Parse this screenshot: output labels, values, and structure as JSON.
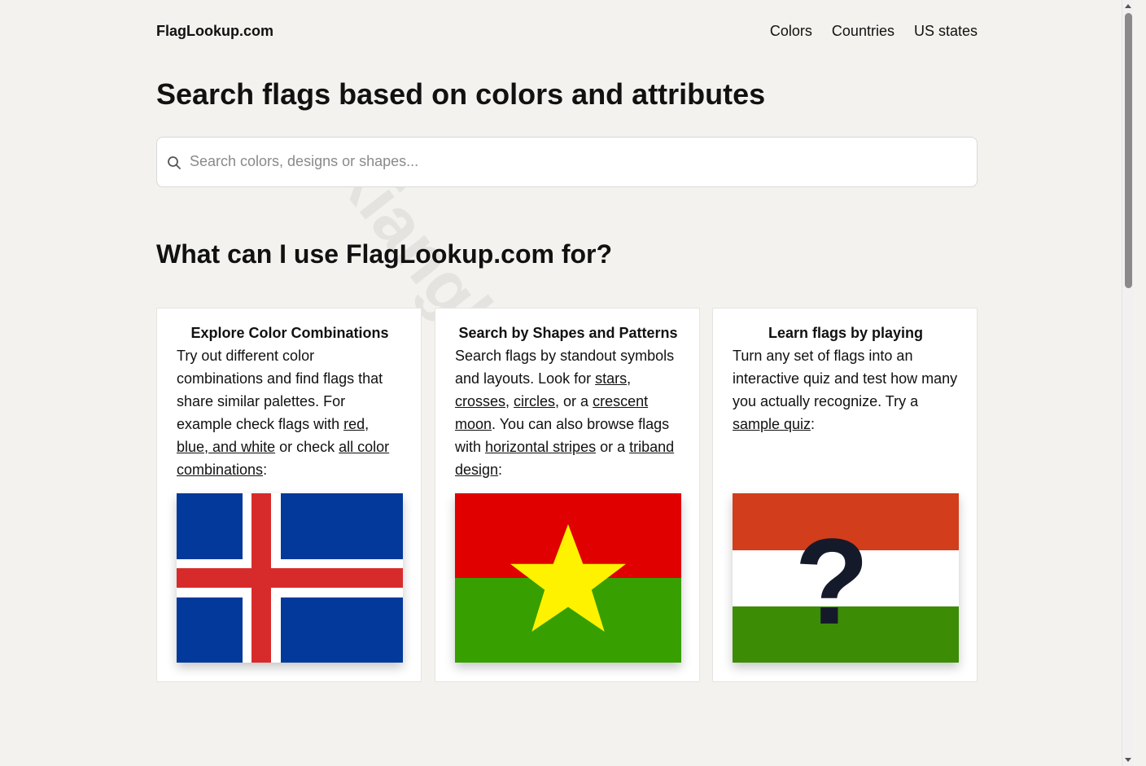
{
  "header": {
    "logo": "FlagLookup.com",
    "nav": [
      "Colors",
      "Countries",
      "US states"
    ]
  },
  "hero": {
    "title": "Search flags based on colors and attributes"
  },
  "search": {
    "placeholder": "Search colors, designs or shapes...",
    "value": "",
    "icon": "search-icon"
  },
  "section": {
    "title": "What can I use FlagLookup.com for?"
  },
  "cards": [
    {
      "title": "Explore Color Combinations",
      "text_1": "Try out different color combinations and find flags that share similar palettes. For example check flags with ",
      "link_1": "red, blue, and white",
      "text_2": " or check ",
      "link_2": "all color combinations",
      "text_3": ":",
      "flag": "Iceland"
    },
    {
      "title": "Search by Shapes and Patterns",
      "text_1": "Search flags by standout symbols and layouts. Look for ",
      "link_1": "stars",
      "text_2": ", ",
      "link_2": "crosses",
      "text_3": ", ",
      "link_3": "circles",
      "text_4": ", or a ",
      "link_4": "crescent moon",
      "text_5": ". You can also browse flags with ",
      "link_5": "horizontal stripes",
      "text_6": " or a ",
      "link_6": "triband design",
      "text_7": ":",
      "flag": "Burkina Faso"
    },
    {
      "title": "Learn flags by playing",
      "text_1": "Turn any set of flags into an interactive quiz and test how many you actually recognize. Try a ",
      "link_1": "sample quiz",
      "text_2": ":",
      "flag": "quiz",
      "quiz_mark": "?"
    }
  ],
  "watermark": "xiangle.site.com",
  "colors": {
    "background": "#f3f2ef",
    "iceland_blue": "#02399a",
    "iceland_red": "#d72b2b",
    "bf_red": "#e00000",
    "bf_green": "#37a000",
    "bf_star": "#fff200",
    "quiz_red": "#d23d1b",
    "quiz_green": "#3c8c06",
    "quiz_mark": "#151a2b"
  }
}
